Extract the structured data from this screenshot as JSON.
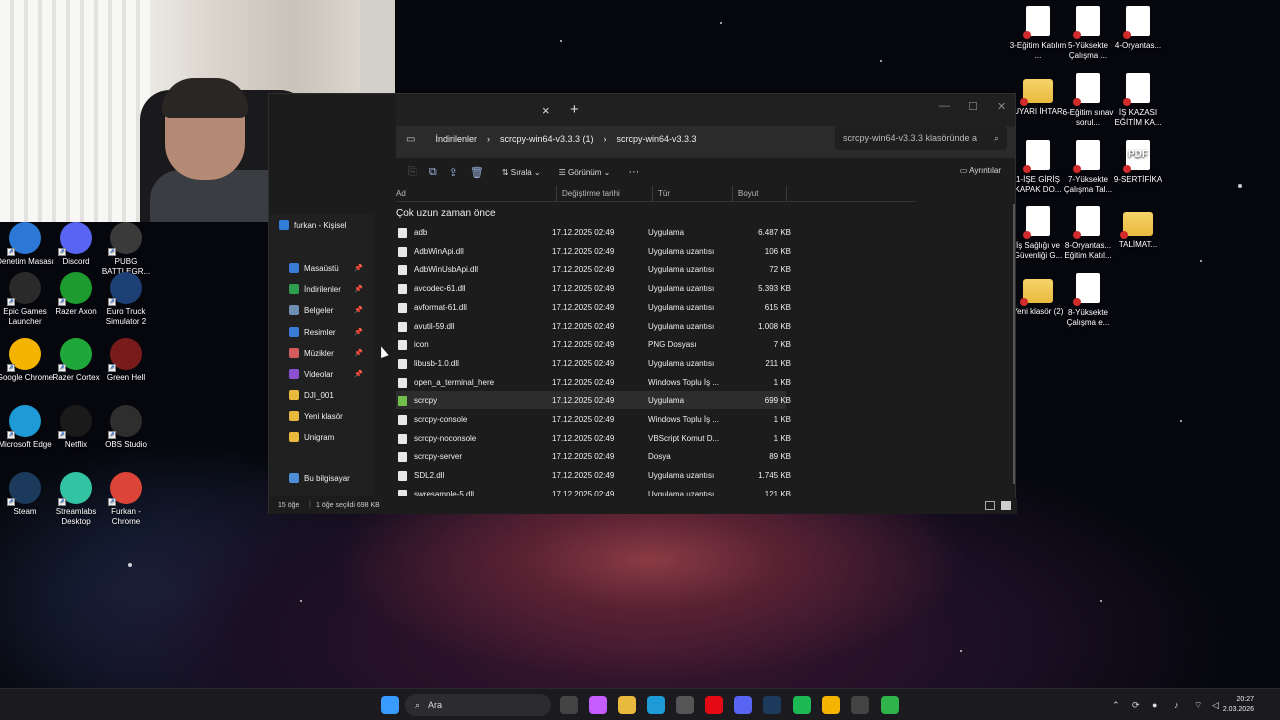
{
  "webcam": {
    "label": "webcam-overlay"
  },
  "desktop_left": [
    {
      "label": "Denetim Masası",
      "icon": "control-panel-icon",
      "color": "#2b78d6"
    },
    {
      "label": "Discord",
      "icon": "discord-icon",
      "color": "#5865f2"
    },
    {
      "label": "PUBG BATTLEGR...",
      "icon": "pubg-icon",
      "color": "#3a3a3a"
    },
    {
      "label": "Epic Games Launcher",
      "icon": "epic-games-icon",
      "color": "#2a2a2a"
    },
    {
      "label": "Razer Axon",
      "icon": "razer-axon-icon",
      "color": "#1d9b2e"
    },
    {
      "label": "Euro Truck Simulator 2",
      "icon": "truck-icon",
      "color": "#1c3f74"
    },
    {
      "label": "Google Chrome",
      "icon": "chrome-icon",
      "color": "#f4b400"
    },
    {
      "label": "Razer Cortex",
      "icon": "razer-cortex-icon",
      "color": "#1ea83a"
    },
    {
      "label": "Green Hell",
      "icon": "green-hell-icon",
      "color": "#7a1b1b"
    },
    {
      "label": "Microsoft Edge",
      "icon": "edge-icon",
      "color": "#1e9ad6"
    },
    {
      "label": "Netflix",
      "icon": "netflix-icon",
      "color": "#1a1a1a"
    },
    {
      "label": "OBS Studio",
      "icon": "obs-icon",
      "color": "#2e2e2e"
    },
    {
      "label": "Steam",
      "icon": "steam-icon",
      "color": "#1b3a5c"
    },
    {
      "label": "Streamlabs Desktop",
      "icon": "streamlabs-icon",
      "color": "#31c3a2"
    },
    {
      "label": "Furkan - Chrome",
      "icon": "chrome-profile-icon",
      "color": "#db4437"
    }
  ],
  "desktop_right": [
    {
      "label": "3-Eğitim Katılım ...",
      "kind": "doc"
    },
    {
      "label": "5-Yüksekte Çalışma ...",
      "kind": "doc"
    },
    {
      "label": "4-Oryantas...",
      "kind": "doc"
    },
    {
      "label": "UYARI İHTAR",
      "kind": "folder"
    },
    {
      "label": "6-Eğitim sınav sorul...",
      "kind": "doc"
    },
    {
      "label": "İŞ KAZASI EĞİTİM KA...",
      "kind": "doc"
    },
    {
      "label": "1-İŞE GİRİŞ KAPAK DO...",
      "kind": "doc"
    },
    {
      "label": "7-Yüksekte Çalışma Tal...",
      "kind": "doc"
    },
    {
      "label": "9-SERTİFİKA",
      "kind": "pdf"
    },
    {
      "label": "İş Sağlığı ve Güvenliği G...",
      "kind": "doc"
    },
    {
      "label": "8-Oryantas... Eğitim Katıl...",
      "kind": "doc"
    },
    {
      "label": "TALİMAT...",
      "kind": "folder"
    },
    {
      "label": "Yeni klasör (2)",
      "kind": "folder"
    },
    {
      "label": "8-Yüksekte Çalışma e...",
      "kind": "doc"
    }
  ],
  "explorer": {
    "tab_close": "×",
    "new_tab": "+",
    "breadcrumb": [
      "İndirilenler",
      "scrcpy-win64-v3.3.3 (1)",
      "scrcpy-win64-v3.3.3"
    ],
    "search_placeholder": "scrcpy-win64-v3.3.3 klasöründe a",
    "toolbar": {
      "sort": "Sırala",
      "view": "Görünüm",
      "more": "···",
      "details": "Ayrıntılar"
    },
    "nav": [
      {
        "label": "furkan - Kişisel",
        "pin": false
      },
      {
        "label": "Masaüstü",
        "pin": true
      },
      {
        "label": "İndirilenler",
        "pin": true
      },
      {
        "label": "Belgeler",
        "pin": true
      },
      {
        "label": "Resimler",
        "pin": true
      },
      {
        "label": "Müzikler",
        "pin": true
      },
      {
        "label": "Videolar",
        "pin": true
      },
      {
        "label": "DJI_001",
        "pin": false
      },
      {
        "label": "Yeni klasör",
        "pin": false
      },
      {
        "label": "Unigram",
        "pin": false
      },
      {
        "label": "Bu bilgisayar",
        "pin": false
      }
    ],
    "columns": {
      "name": "Ad",
      "modified": "Değiştirme tarihi",
      "type": "Tür",
      "size": "Boyut"
    },
    "group": "Çok uzun zaman önce",
    "files": [
      {
        "name": "adb",
        "date": "17.12.2025 02:49",
        "type": "Uygulama",
        "size": "6.487 KB"
      },
      {
        "name": "AdbWinApi.dll",
        "date": "17.12.2025 02:49",
        "type": "Uygulama uzantısı",
        "size": "106 KB"
      },
      {
        "name": "AdbWinUsbApi.dll",
        "date": "17.12.2025 02:49",
        "type": "Uygulama uzantısı",
        "size": "72 KB"
      },
      {
        "name": "avcodec-61.dll",
        "date": "17.12.2025 02:49",
        "type": "Uygulama uzantısı",
        "size": "5.393 KB"
      },
      {
        "name": "avformat-61.dll",
        "date": "17.12.2025 02:49",
        "type": "Uygulama uzantısı",
        "size": "615 KB"
      },
      {
        "name": "avutil-59.dll",
        "date": "17.12.2025 02:49",
        "type": "Uygulama uzantısı",
        "size": "1.008 KB"
      },
      {
        "name": "icon",
        "date": "17.12.2025 02:49",
        "type": "PNG Dosyası",
        "size": "7 KB"
      },
      {
        "name": "libusb-1.0.dll",
        "date": "17.12.2025 02:49",
        "type": "Uygulama uzantısı",
        "size": "211 KB"
      },
      {
        "name": "open_a_terminal_here",
        "date": "17.12.2025 02:49",
        "type": "Windows Toplu İş ...",
        "size": "1 KB"
      },
      {
        "name": "scrcpy",
        "date": "17.12.2025 02:49",
        "type": "Uygulama",
        "size": "699 KB"
      },
      {
        "name": "scrcpy-console",
        "date": "17.12.2025 02:49",
        "type": "Windows Toplu İş ...",
        "size": "1 KB"
      },
      {
        "name": "scrcpy-noconsole",
        "date": "17.12.2025 02:49",
        "type": "VBScript Komut D...",
        "size": "1 KB"
      },
      {
        "name": "scrcpy-server",
        "date": "17.12.2025 02:49",
        "type": "Dosya",
        "size": "89 KB"
      },
      {
        "name": "SDL2.dll",
        "date": "17.12.2025 02:49",
        "type": "Uygulama uzantısı",
        "size": "1.745 KB"
      },
      {
        "name": "swresample-5.dll",
        "date": "17.12.2025 02:49",
        "type": "Uygulama uzantısı",
        "size": "121 KB"
      }
    ],
    "status": {
      "count": "15 öğe",
      "selected": "1 öğe seçildi 698 KB"
    }
  },
  "taskbar": {
    "search": "Ara",
    "time": "20:27",
    "date": "2.03.2026",
    "apps": [
      "start-icon",
      "file-explorer-icon",
      "copilot-icon",
      "folder-icon",
      "edge-icon",
      "store-icon",
      "netflix-icon",
      "discord-icon",
      "steam-icon",
      "spotify-icon",
      "chrome-icon",
      "obs-icon",
      "scrcpy-icon"
    ]
  }
}
